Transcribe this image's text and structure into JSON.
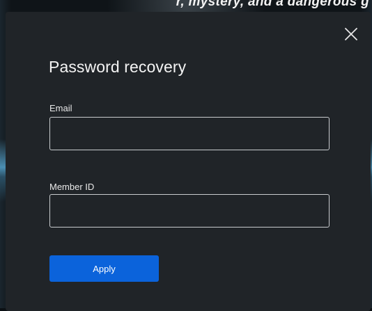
{
  "backdrop": {
    "partial_text": "r, mystery, and a dangerous g"
  },
  "modal": {
    "title": "Password recovery",
    "close_icon": "close-icon",
    "fields": {
      "email": {
        "label": "Email",
        "value": "",
        "placeholder": ""
      },
      "member_id": {
        "label": "Member ID",
        "value": "",
        "placeholder": ""
      }
    },
    "apply_label": "Apply"
  },
  "colors": {
    "modal_bg": "#202428",
    "accent": "#0b63db",
    "text": "#f4f4f4",
    "input_border": "#c9cccf"
  }
}
